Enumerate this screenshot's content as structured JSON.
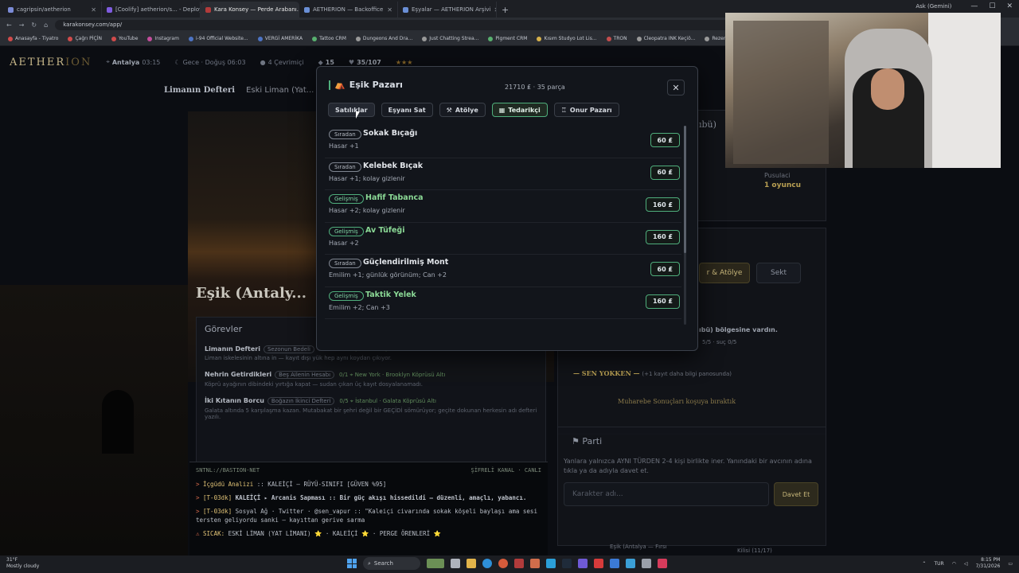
{
  "browser": {
    "tabs": [
      {
        "label": "cagripsin/aetherion"
      },
      {
        "label": "[Coolify] aetherion/s... - Deploy"
      },
      {
        "label": "Kara Konsey — Perde Arabanı..."
      },
      {
        "label": "AETHERION — Backoffice"
      },
      {
        "label": "Eşyalar — AETHERION Arşivi"
      }
    ],
    "new_tab": "+",
    "account": "Ask (Gemini)",
    "url": "karakonsey.com/app/",
    "bookmarks": [
      "Anasayfa - Tiyatro",
      "Çağrı PİÇİN",
      "YouTube",
      "Instagram",
      "i-94 Official Website...",
      "VERGİ AMERİKA",
      "Tattoo CRM",
      "Dungeons And Dra...",
      "Just Chatting Strea...",
      "Pigment CRM",
      "Kısım Studyo Lot Lis...",
      "TRON",
      "Cleopatra INK Keçiö...",
      "Rezervasyonlar | Cle..."
    ]
  },
  "app": {
    "logo_main": "AETHER",
    "logo_faded": "ION",
    "nav": [
      {
        "label": "Antalya",
        "sub": "03:15"
      },
      {
        "label": "Gece · Doğuş 06:03",
        "sub": ""
      },
      {
        "label": "4 Çevrimiçi",
        "sub": ""
      },
      {
        "label": "15",
        "sub": ""
      },
      {
        "label": "35/107",
        "sub": ""
      },
      {
        "label": "★★★",
        "sub": ""
      }
    ],
    "breadcrumb": {
      "current": "Limanın Defteri",
      "other": "Eski Liman (Yat..."
    },
    "place_heading": "Eşik (Antaly...",
    "gorevler": {
      "title": "Görevler",
      "quests": [
        {
          "name": "Limanın Defteri",
          "tag": "Sezonun Bedeli",
          "goal": "· Eski Liman (Yat Limanı)",
          "desc": "Liman iskelesinin altına in — kayıt dışı yük hep aynı koydan çıkıyor."
        },
        {
          "name": "Nehrin Getirdikleri",
          "tag": "Beş Ailenin Hesabı",
          "goal": "0/1  ⌖ New York · Brooklyn Köprüsü Altı",
          "desc": "Köprü ayağının dibindeki yırtığa kapat — sudan çıkan üç kayıt dosyalanamadı."
        },
        {
          "name": "İki Kıtanın Borcu",
          "tag": "Boğazın İkinci Defteri",
          "goal": "0/5  ⌖ İstanbul · Galata Köprüsü Altı",
          "desc": "Galata altında 5 karşılaşma kazan. Mutabakat bir şehri değil bir GEÇİDİ sömürüyor; geçite dokunan herkesin adı defteri yazılı."
        }
      ]
    },
    "terminal": {
      "header_left": "SNTNL://BASTION-NET",
      "header_right": "ŞİFRELİ KANAL · CANLI",
      "lines": [
        {
          "prefix": ">",
          "head": "İçgüdü Analizi",
          "text": ":: KALEİÇİ — RÜYÜ-SINIFI [GÜVEN %95]"
        },
        {
          "prefix": ">",
          "head": "[T-03dk]",
          "text": "KALEİÇİ ▸ Arcanis Sapması :: Bir güç akışı hissedildi — düzenli, amaçlı, yabancı."
        },
        {
          "prefix": ">",
          "head": "[T-03dk]",
          "text": "Sosyal Ağ · Twitter · @sen_vapur :: \"Kaleiçi civarında sokak köşeli baylaşı ama sesi tersten geliyordu sanki — kayıttan gerive sarma"
        },
        {
          "prefix": "⚠",
          "head": "SICAK:",
          "text": "ESKİ LİMAN (YAT LİMANI) ⭐ · KALEİÇİ ⭐ · PERGE ÖRENLERİ ⭐"
        }
      ]
    },
    "right": {
      "top_title": "ıbü)",
      "status": "Pusulaci",
      "status_sub": "1 oyuncu",
      "tab_active": "r & Atölye",
      "tab_other": "Sekt",
      "arrival": "ıbü) bölgesine vardın.",
      "arrival_sub": "5/5 · suç 0/5",
      "absent": "— SEN YOKKEN —",
      "absent_sub": "(+1 kayıt daha bilgi panosunda)",
      "absent_line": "Muharebe Sonuçları koşuya bıraktık",
      "parti_title": "Parti",
      "parti_desc": "Yanlara yalnızca AYNI TÜRDEN 2-4 kişi birlikte iner. Yanındaki bir avcının adına tıkla ya da adıyla davet et.",
      "char_placeholder": "Karakter adı...",
      "invite_button": "Davet Et",
      "bottom_left": "Eşik (Antalya — Fırsı",
      "bottom_right": "Kilisi (11/17)"
    }
  },
  "modal": {
    "title": "Eşik Pazarı",
    "meta": "21710 ₤ · 35 parça",
    "close": "✕",
    "tabs": [
      {
        "label": "Satılıklar",
        "icon": ""
      },
      {
        "label": "Eşyanı Sat",
        "icon": ""
      },
      {
        "label": "Atölye",
        "icon": "hammer-icon"
      },
      {
        "label": "Tedarikçi",
        "icon": "cart-icon"
      },
      {
        "label": "Onur Pazarı",
        "icon": "medal-icon"
      }
    ],
    "items": [
      {
        "rarity": "Sıradan",
        "name": "Sokak Bıçağı",
        "desc": "Hasar +1",
        "price": "60 ₤",
        "advanced": false
      },
      {
        "rarity": "Sıradan",
        "name": "Kelebek Bıçak",
        "desc": "Hasar +1; kolay gizlenir",
        "price": "60 ₤",
        "advanced": false
      },
      {
        "rarity": "Gelişmiş",
        "name": "Hafif Tabanca",
        "desc": "Hasar +2; kolay gizlenir",
        "price": "160 ₤",
        "advanced": true
      },
      {
        "rarity": "Gelişmiş",
        "name": "Av Tüfeği",
        "desc": "Hasar +2",
        "price": "160 ₤",
        "advanced": true
      },
      {
        "rarity": "Sıradan",
        "name": "Güçlendirilmiş Mont",
        "desc": "Emilim +1; günlük görünüm; Can +2",
        "price": "60 ₤",
        "advanced": false
      },
      {
        "rarity": "Gelişmiş",
        "name": "Taktik Yelek",
        "desc": "Emilim +2; Can +3",
        "price": "160 ₤",
        "advanced": true
      }
    ]
  },
  "taskbar": {
    "weather_temp": "31°F",
    "weather_desc": "Mostly cloudy",
    "search": "Search",
    "lang": "TUR",
    "time": "8:15 PM",
    "date": "7/31/2026"
  },
  "colors": {
    "accent": "#4fae7c",
    "gold": "#c8b88a",
    "bg": "#0b0d12"
  }
}
